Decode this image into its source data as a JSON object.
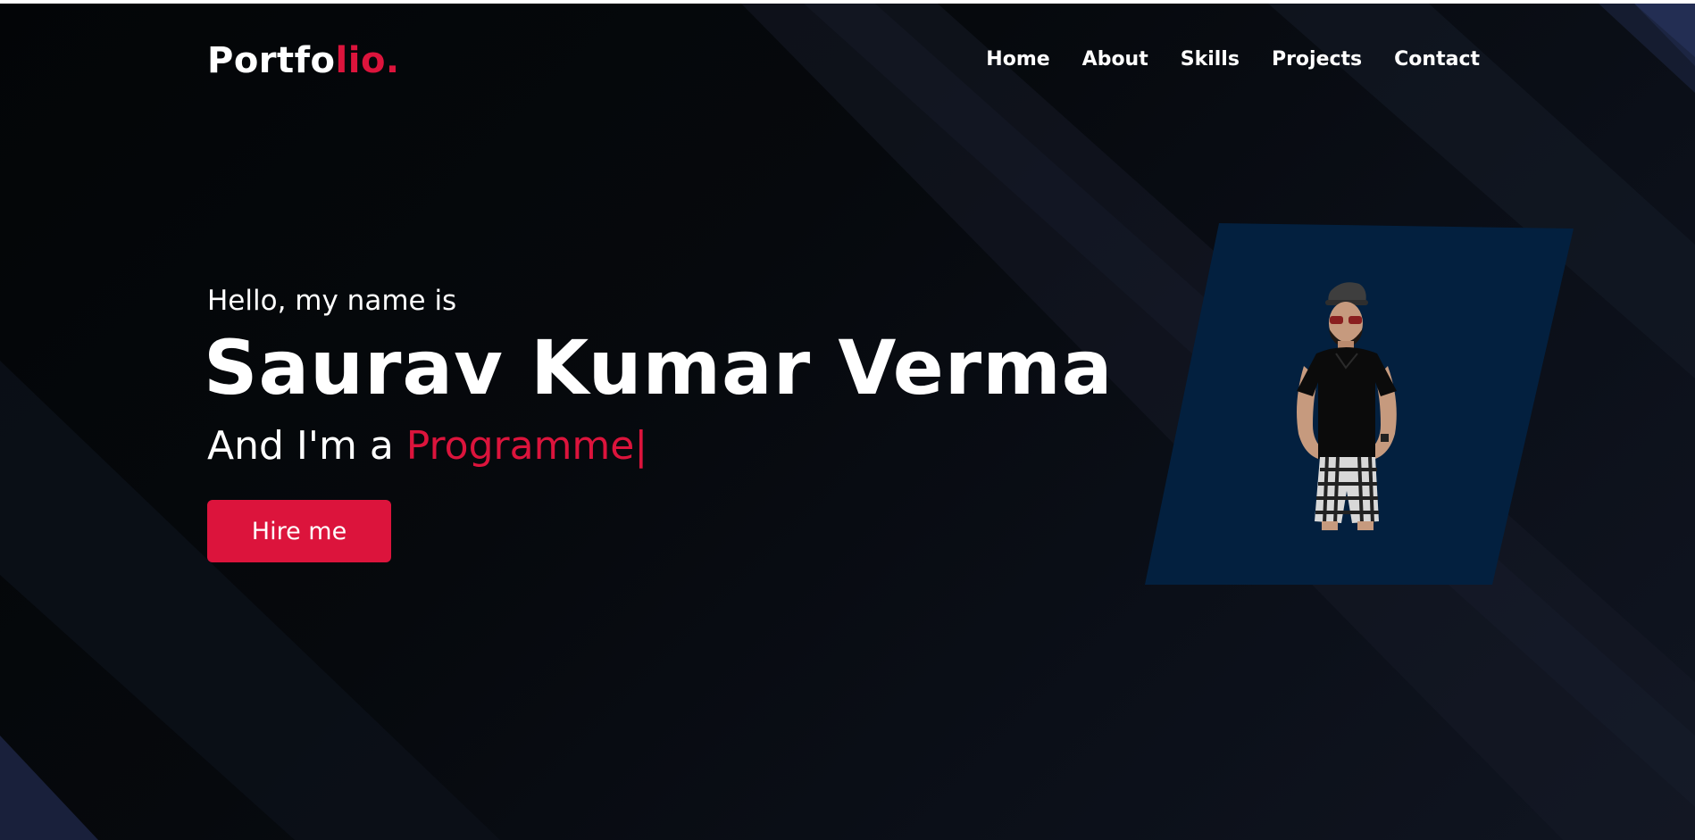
{
  "nav": {
    "logo": {
      "main": "Portfo",
      "accent": "lio."
    },
    "items": [
      {
        "label": "Home"
      },
      {
        "label": "About"
      },
      {
        "label": "Skills"
      },
      {
        "label": "Projects"
      },
      {
        "label": "Contact"
      }
    ]
  },
  "hero": {
    "greeting": "Hello, my name is",
    "name": "Saurav Kumar Verma",
    "role_prefix": "And I'm a ",
    "role_typed": "Programme",
    "role_cursor": "|",
    "hire_button": "Hire me"
  },
  "colors": {
    "accent": "#dc143c",
    "background": "#06090d",
    "card": "#03203f",
    "text": "#ffffff"
  }
}
